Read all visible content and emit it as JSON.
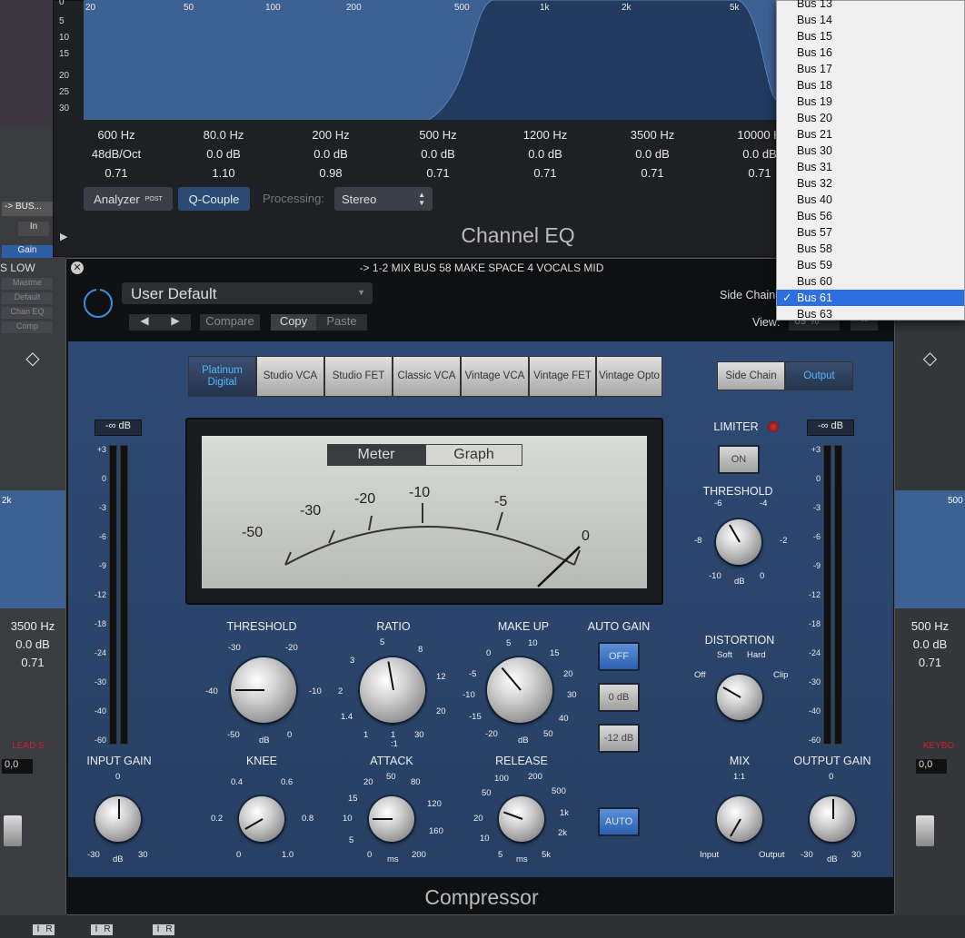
{
  "background": {
    "left_labels": [
      "-> BUS...",
      "In",
      "Gain",
      "S LOW",
      "Mastme",
      "Default",
      "Chan EQ",
      "Comp"
    ],
    "left_values": {
      "freq": "3500 Hz",
      "gain": "0.0 dB",
      "q": "0.71",
      "k": "2k",
      "fader": "0,0",
      "name": "LEAD S"
    },
    "right_values": {
      "freq": "500 Hz",
      "gain": "0.0 dB",
      "q": "0.71",
      "k": "500",
      "fader": "0,0",
      "name": "KEYBO"
    },
    "io": [
      "I",
      "R"
    ]
  },
  "eq": {
    "freq_labels": [
      "20",
      "50",
      "100",
      "200",
      "500",
      "1k",
      "2k",
      "5k"
    ],
    "db_labels": [
      "0",
      "5",
      "10",
      "15",
      "20",
      "25",
      "30"
    ],
    "bands": [
      {
        "freq": "600 Hz",
        "gain": "48dB/Oct",
        "q": "0.71"
      },
      {
        "freq": "80.0 Hz",
        "gain": "0.0 dB",
        "q": "1.10"
      },
      {
        "freq": "200 Hz",
        "gain": "0.0 dB",
        "q": "0.98"
      },
      {
        "freq": "500 Hz",
        "gain": "0.0 dB",
        "q": "0.71"
      },
      {
        "freq": "1200 Hz",
        "gain": "0.0 dB",
        "q": "0.71"
      },
      {
        "freq": "3500 Hz",
        "gain": "0.0 dB",
        "q": "0.71"
      },
      {
        "freq": "10000 H",
        "gain": "0.0 dB",
        "q": "0.71"
      }
    ],
    "analyzer": "Analyzer",
    "post": "POST",
    "qcouple": "Q-Couple",
    "processing_label": "Processing:",
    "processing_value": "Stereo",
    "title": "Channel EQ"
  },
  "compressor": {
    "header": "-> 1-2 MIX BUS 58 MAKE SPACE 4 VOCALS MID",
    "preset": "User Default",
    "compare": "Compare",
    "copy": "Copy",
    "paste": "Paste",
    "side_chain_label": "Side Chain",
    "view_label": "View:",
    "view_value": "69 %",
    "models": [
      "Platinum Digital",
      "Studio VCA",
      "Studio FET",
      "Classic VCA",
      "Vintage VCA",
      "Vintage FET",
      "Vintage Opto"
    ],
    "sc_tab": "Side Chain",
    "out_tab": "Output",
    "input_readout": "-∞ dB",
    "output_readout": "-∞ dB",
    "meter_tab": "Meter",
    "graph_tab": "Graph",
    "meter_scale": [
      "-50",
      "-30",
      "-20",
      "-10",
      "-5",
      "0"
    ],
    "level_scale": [
      "+3",
      "0",
      "-3",
      "-6",
      "-9",
      "-12",
      "-18",
      "-24",
      "-30",
      "-40",
      "-60"
    ],
    "threshold": {
      "label": "THRESHOLD",
      "ticks": [
        "-30",
        "-20",
        "-40",
        "-10",
        "-50",
        "dB",
        "0"
      ]
    },
    "ratio": {
      "label": "RATIO",
      "ticks": [
        "5",
        "8",
        "3",
        "12",
        "2",
        "20",
        "1.4",
        "30",
        "1",
        "1",
        ":1"
      ]
    },
    "makeup": {
      "label": "MAKE UP",
      "ticks": [
        "0",
        "5",
        "10",
        "15",
        "-5",
        "20",
        "-10",
        "30",
        "-15",
        "40",
        "-20",
        "50",
        "dB"
      ]
    },
    "autogain": {
      "label": "AUTO GAIN",
      "off": "OFF",
      "zero": "0 dB",
      "minus12": "-12 dB"
    },
    "knee": {
      "label": "KNEE",
      "ticks": [
        "0.4",
        "0.6",
        "0.2",
        "0.8",
        "0",
        "1.0"
      ]
    },
    "attack": {
      "label": "ATTACK",
      "ticks": [
        "20",
        "50",
        "80",
        "15",
        "120",
        "10",
        "160",
        "5",
        "0",
        "ms",
        "200"
      ]
    },
    "release": {
      "label": "RELEASE",
      "ticks": [
        "100",
        "200",
        "50",
        "500",
        "1k",
        "20",
        "2k",
        "10",
        "5",
        "ms",
        "5k"
      ]
    },
    "auto": "AUTO",
    "input_gain": {
      "label": "INPUT GAIN",
      "ticks": [
        "0",
        "-30",
        "dB",
        "30"
      ]
    },
    "limiter": {
      "label": "LIMITER",
      "on": "ON"
    },
    "lim_threshold": {
      "label": "THRESHOLD",
      "ticks": [
        "-6",
        "-4",
        "-8",
        "-2",
        "-10",
        "dB",
        "0"
      ]
    },
    "distortion": {
      "label": "DISTORTION",
      "ticks": [
        "Soft",
        "Hard",
        "Off",
        "Clip"
      ]
    },
    "mix": {
      "label": "MIX",
      "ticks": [
        "1:1",
        "Input",
        "Output"
      ]
    },
    "output_gain": {
      "label": "OUTPUT GAIN",
      "ticks": [
        "0",
        "-30",
        "dB",
        "30"
      ]
    },
    "title": "Compressor"
  },
  "bus_menu": {
    "items": [
      "Bus 13",
      "Bus 14",
      "Bus 15",
      "Bus 16",
      "Bus 17",
      "Bus 18",
      "Bus 19",
      "Bus 20",
      "Bus 21",
      "Bus 30",
      "Bus 31",
      "Bus 32",
      "Bus 40",
      "Bus 56",
      "Bus 57",
      "Bus 58",
      "Bus 59",
      "Bus 60",
      "Bus 61",
      "Bus 63"
    ],
    "selected": "Bus 61",
    "check": "✓"
  }
}
